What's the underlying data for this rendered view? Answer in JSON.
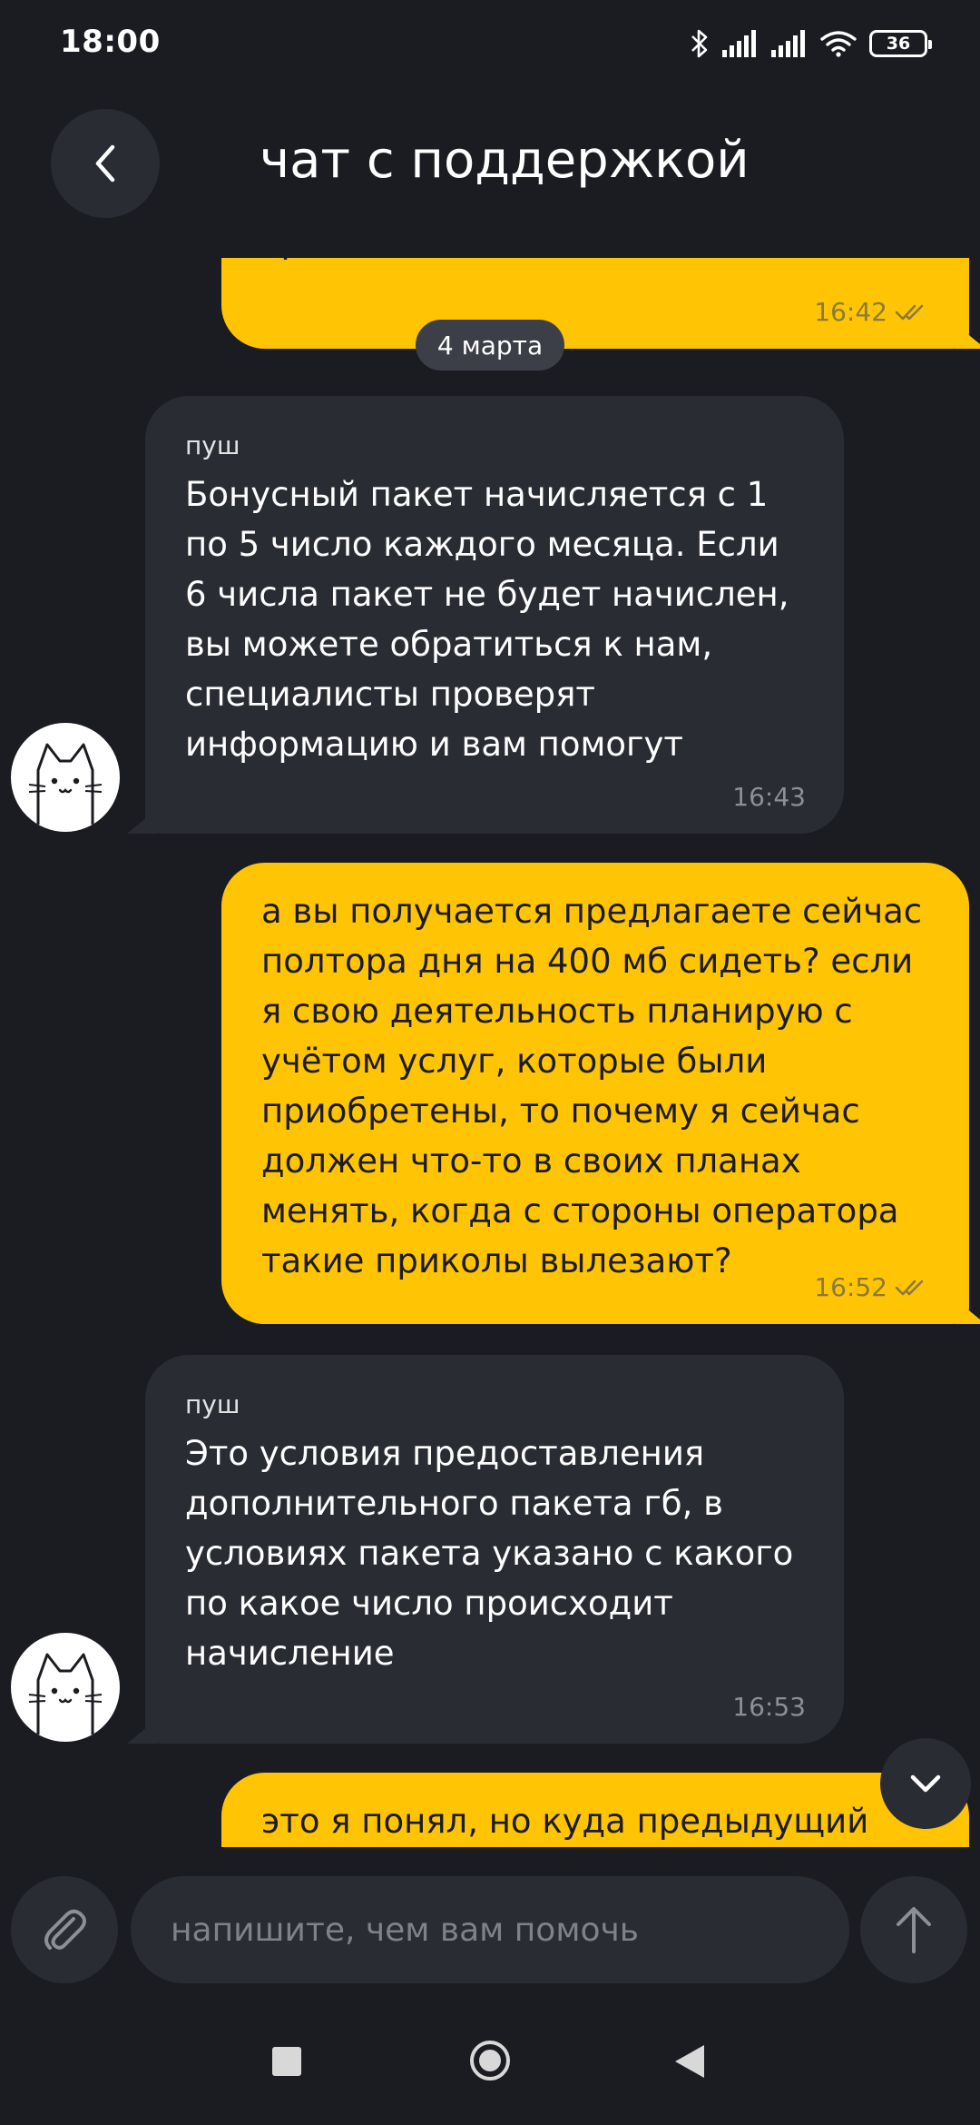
{
  "status_bar": {
    "time": "18:00",
    "battery": "36",
    "icons": [
      "bluetooth-icon",
      "signal-icon",
      "signal-icon",
      "wifi-icon",
      "battery-icon"
    ]
  },
  "header": {
    "title": "чат с поддержкой",
    "back_icon": "chevron-left-icon"
  },
  "chat": {
    "partial_top_message": {
      "text": "тратился. а сейчас его нет",
      "time": "16:42"
    },
    "date_separator": "4 марта",
    "messages": [
      {
        "direction": "in",
        "sender": "пуш",
        "text": "Бонусный пакет начисляется с 1 по 5 число каждого месяца. Если 6 числа пакет не будет начислен, вы можете обратиться к нам, специалисты проверят информацию и вам помогут",
        "time": "16:43"
      },
      {
        "direction": "out",
        "text": "а вы получается предлагаете сейчас полтора дня на 400 мб сидеть? если я свою деятельность планирую с учётом услуг, которые были приобретены, то почему я сейчас должен что-то в своих планах менять, когда с стороны оператора такие приколы вылезают?",
        "time": "16:52"
      },
      {
        "direction": "in",
        "sender": "пуш",
        "text": "Это условия предоставления дополнительного пакета гб, в условиях пакета указано с какого по какое число происходит начисление",
        "time": "16:53"
      }
    ],
    "partial_bottom_message": {
      "text": "это я понял, но куда предыдущий"
    }
  },
  "input": {
    "placeholder": "напишите, чем вам помочь",
    "value": ""
  },
  "colors": {
    "background": "#1b1c21",
    "outgoing_bubble": "#ffc403",
    "incoming_bubble": "#2a2c33",
    "date_pill": "#3c3f48"
  }
}
